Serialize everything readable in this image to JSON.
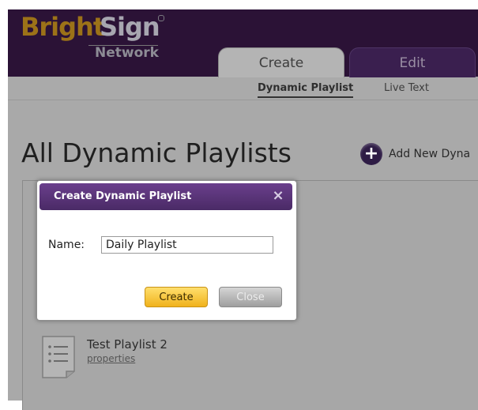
{
  "logo": {
    "bright": "Bright",
    "sign": "Sign",
    "network": "Network"
  },
  "tabs": [
    {
      "label": "Create",
      "active": true
    },
    {
      "label": "Edit",
      "active": false
    }
  ],
  "subnav": {
    "items": [
      {
        "label": "Dynamic Playlist",
        "active": true
      },
      {
        "label": "Live Text",
        "active": false
      }
    ]
  },
  "page": {
    "title": "All Dynamic Playlists",
    "add_new_label": "Add New Dyna"
  },
  "playlists": [
    {
      "name": "Test Playlist 2",
      "properties_label": "properties"
    }
  ],
  "modal": {
    "title": "Create Dynamic Playlist",
    "close_icon": "×",
    "name_label": "Name:",
    "name_value": "Daily Playlist",
    "create_label": "Create",
    "close_label": "Close"
  },
  "colors": {
    "header_bg": "#2b1236",
    "accent_purple": "#5a3478",
    "create_button": "#f5c23a",
    "logo_gold": "#9c7218"
  },
  "icons": {
    "add": "plus-circle-icon",
    "close": "close-icon",
    "playlist": "document-list-icon"
  }
}
